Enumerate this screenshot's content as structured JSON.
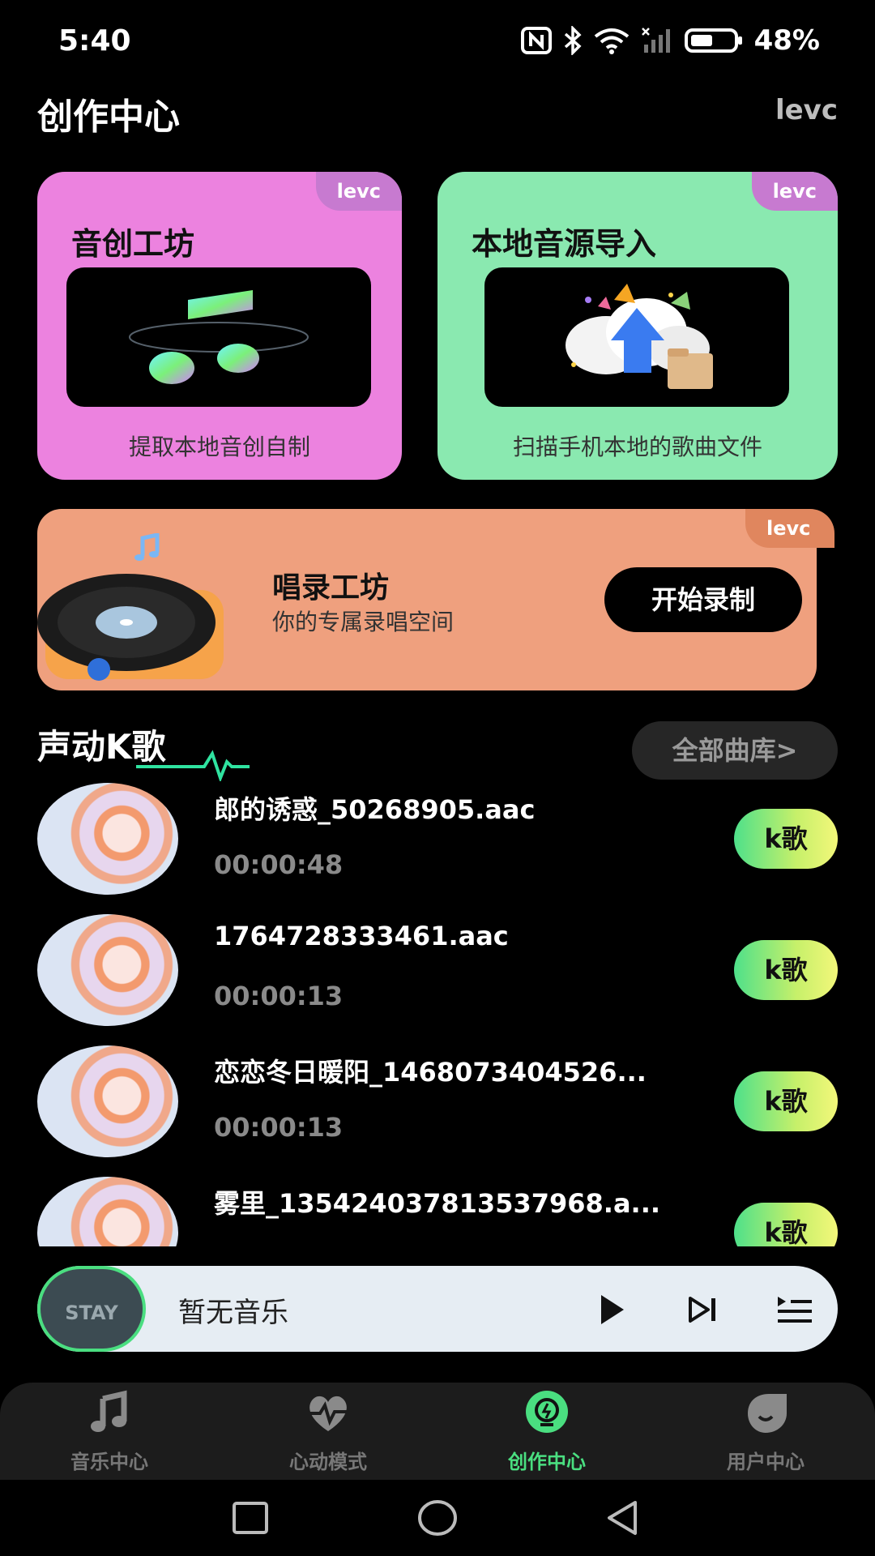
{
  "status_bar": {
    "time": "5:40",
    "battery": "48%",
    "icons": [
      "nfc-icon",
      "bluetooth-icon",
      "wifi-icon",
      "signal-icon",
      "battery-icon"
    ]
  },
  "header": {
    "title": "创作中心",
    "brand": "levc"
  },
  "cards": [
    {
      "title": "音创工坊",
      "subtitle": "提取本地音创自制",
      "tag": "levc",
      "bg": "#ec82df",
      "tag_bg": "#c77ad0"
    },
    {
      "title": "本地音源导入",
      "subtitle": "扫描手机本地的歌曲文件",
      "tag": "levc",
      "bg": "#8ae9b0",
      "tag_bg": "#c77ad0"
    }
  ],
  "banner": {
    "title": "唱录工坊",
    "subtitle": "你的专属录唱空间",
    "button": "开始录制",
    "tag": "levc",
    "bg": "#efa07e"
  },
  "karaoke": {
    "title": "声动K歌",
    "library_button": "全部曲库>",
    "songs": [
      {
        "name": "郎的诱惑_50268905.aac",
        "duration": "00:00:48",
        "action": "k歌"
      },
      {
        "name": "1764728333461.aac",
        "duration": "00:00:13",
        "action": "k歌"
      },
      {
        "name": "恋恋冬日暖阳_1468073404526...",
        "duration": "00:00:13",
        "action": "k歌"
      },
      {
        "name": "雾里_135424037813537968.a...",
        "duration": "",
        "action": "k歌"
      }
    ]
  },
  "player": {
    "title": "暂无音乐",
    "cover_text": "STAY",
    "controls": [
      "play-icon",
      "next-icon",
      "playlist-icon"
    ]
  },
  "bottom_nav": {
    "items": [
      {
        "label": "音乐中心",
        "icon": "music-note-icon",
        "active": false
      },
      {
        "label": "心动模式",
        "icon": "heartbeat-icon",
        "active": false
      },
      {
        "label": "创作中心",
        "icon": "bulb-icon",
        "active": true
      },
      {
        "label": "用户中心",
        "icon": "user-face-icon",
        "active": false
      }
    ],
    "active_color": "#4ade80"
  },
  "system_nav": [
    "recent-apps-icon",
    "home-icon",
    "back-icon"
  ]
}
